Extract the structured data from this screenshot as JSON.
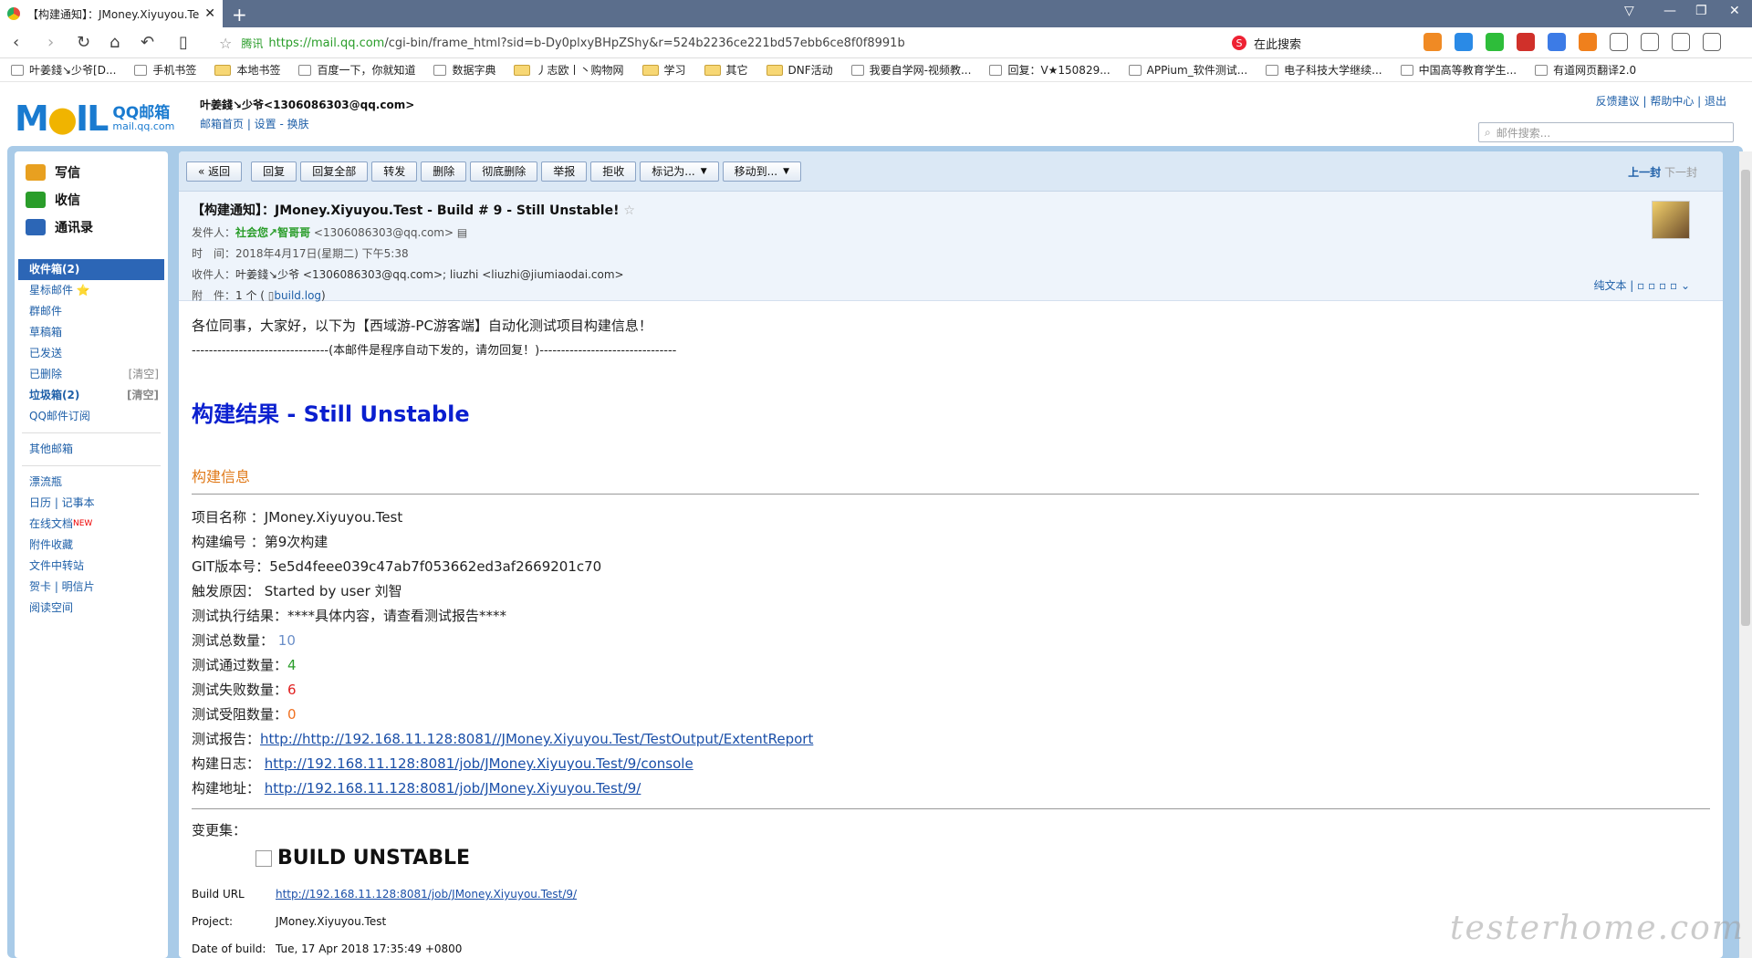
{
  "browser": {
    "tab_title": "【构建通知】：JMoney.Xiyuyou.Te",
    "url_prefix": "腾讯",
    "url_green": "https://mail.qq.com",
    "url_rest": "/cgi-bin/frame_html?sid=b-Dy0plxyBHpZShy&r=524b2236ce221bd57ebb6ce8f0f8991b",
    "search_placeholder": "在此搜索"
  },
  "bookmarks": [
    "叶姜錢↘少爷[D...",
    "手机书签",
    "本地书签",
    "百度一下，你就知道",
    "数据字典",
    "丿志欧丨丶购物网",
    "学习",
    "其它",
    "DNF活动",
    "我要自学网-视频教...",
    "回复：V★150829...",
    "APPium_软件测试...",
    "电子科技大学继续...",
    "中国高等教育学生...",
    "有道网页翻译2.0"
  ],
  "mail_header": {
    "logo_text": "M",
    "logo_qq": "QQ邮箱",
    "logo_domain": "mail.qq.com",
    "user": "叶姜錢↘少爷<1306086303@qq.com>",
    "user_links": "邮箱首页 | 设置 - 换肤",
    "top_links": "反馈建议 | 帮助中心 | 退出",
    "search_placeholder": "邮件搜索..."
  },
  "sidebar": {
    "quick": [
      {
        "label": "写信",
        "icon": "write-icon"
      },
      {
        "label": "收信",
        "icon": "inbox-download-icon"
      },
      {
        "label": "通讯录",
        "icon": "contacts-icon"
      }
    ],
    "folders": [
      {
        "label": "收件箱(2)",
        "active": true,
        "bold": true,
        "clear": ""
      },
      {
        "label": "星标邮件 ⭐",
        "active": false,
        "bold": false,
        "clear": ""
      },
      {
        "label": "群邮件",
        "active": false,
        "bold": false,
        "clear": ""
      },
      {
        "label": "草稿箱",
        "active": false,
        "bold": false,
        "clear": ""
      },
      {
        "label": "已发送",
        "active": false,
        "bold": false,
        "clear": ""
      },
      {
        "label": "已删除",
        "active": false,
        "bold": false,
        "clear": "[清空]"
      },
      {
        "label": "垃圾箱(2)",
        "active": false,
        "bold": true,
        "clear": "[清空]"
      },
      {
        "label": "QQ邮件订阅",
        "active": false,
        "bold": false,
        "clear": ""
      }
    ],
    "other": "其他邮箱",
    "extras": [
      "漂流瓶",
      "日历 | 记事本",
      "在线文档",
      "附件收藏",
      "文件中转站",
      "贺卡 | 明信片",
      "阅读空间"
    ],
    "new_badge": "NEW"
  },
  "toolbar": {
    "buttons": [
      "« 返回",
      "回复",
      "回复全部",
      "转发",
      "删除",
      "彻底删除",
      "举报",
      "拒收"
    ],
    "dropdowns": [
      "标记为...",
      "移动到..."
    ],
    "prev": "上一封",
    "next": "下一封"
  },
  "mail": {
    "subject": "【构建通知】：JMoney.Xiyuyou.Test - Build # 9 - Still Unstable!",
    "from_label": "发件人：",
    "from_name": "社会您↗智哥哥",
    "from_addr": "<1306086303@qq.com>",
    "time_label": "时　间：",
    "time": "2018年4月17日(星期二) 下午5:38",
    "to_label": "收件人：",
    "to": "叶姜錢↘少爷 <1306086303@qq.com>; liuzhi <liuzhi@jiumiaodai.com>",
    "attach_label": "附　件：",
    "attach_count": "1 个 (",
    "attach_file": "build.log",
    "attach_close": ")",
    "view_opts": "纯文本 |"
  },
  "body": {
    "greeting": "各位同事，大家好，以下为【西域游-PC游客端】自动化测试项目构建信息！",
    "notice": "--------------------------------(本邮件是程序自动下发的，请勿回复！)--------------------------------",
    "result_title": "构建结果 - Still Unstable",
    "info_title": "构建信息",
    "project": "项目名称 ：JMoney.Xiyuyou.Test",
    "build_no": "构建编号 ：第9次构建",
    "git": "GIT版本号：5e5d4feee039c47ab7f053662ed3af2669201c70",
    "trigger": "触发原因： Started by user 刘智",
    "exec_result": "测试执行结果：****具体内容，请查看测试报告****",
    "total_label": "测试总数量：",
    "total": "10",
    "pass_label": "测试通过数量：",
    "pass": "4",
    "fail_label": "测试失败数量：",
    "fail": "6",
    "block_label": "测试受阻数量：",
    "block": "0",
    "report_label": "测试报告：",
    "report_url": "http://http://192.168.11.128:8081//JMoney.Xiyuyou.Test/TestOutput/ExtentReport",
    "log_label": "构建日志：",
    "log_url": "http://192.168.11.128:8081/job/JMoney.Xiyuyou.Test/9/console",
    "addr_label": "构建地址：",
    "addr_url": "http://192.168.11.128:8081/job/JMoney.Xiyuyou.Test/9/",
    "changes": "变更集：",
    "build_status": "BUILD UNSTABLE",
    "build_url_label": "Build URL",
    "build_url": "http://192.168.11.128:8081/job/JMoney.Xiyuyou.Test/9/",
    "project_label": "Project:",
    "project_value": "JMoney.Xiyuyou.Test",
    "date_label": "Date of build:",
    "date_value": "Tue, 17 Apr 2018 17:35:49 +0800"
  },
  "watermark": "testerhome.com"
}
